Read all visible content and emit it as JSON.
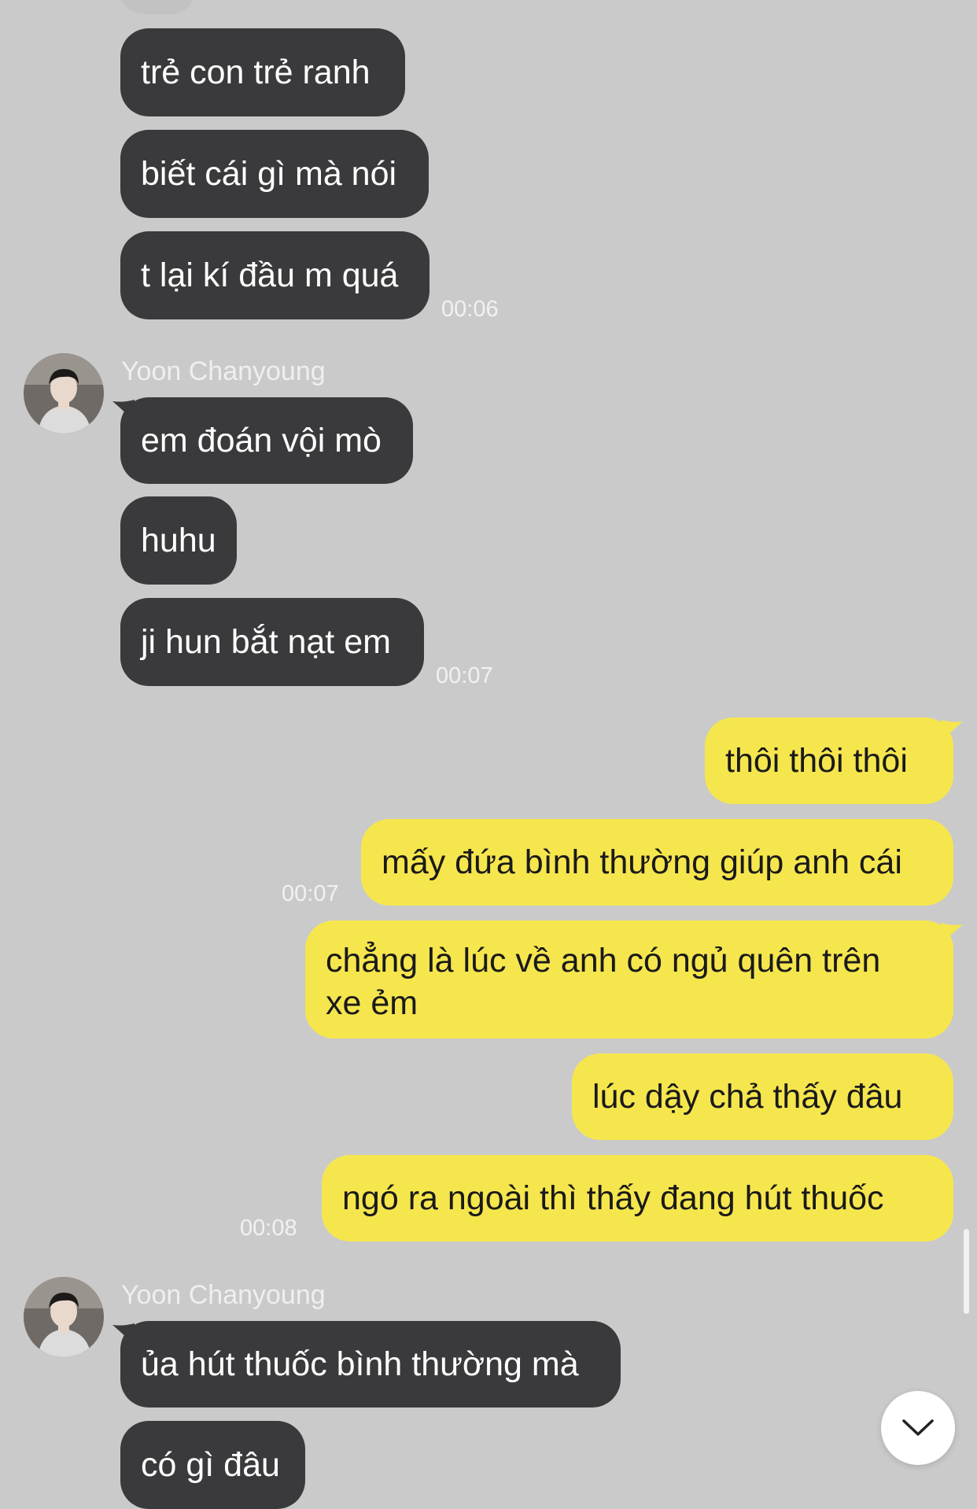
{
  "contact": {
    "name": "Yoon Chanyoung"
  },
  "colors": {
    "background": "#cacaca",
    "incoming": "#3a3a3c",
    "outgoing": "#f6e64e"
  },
  "groups": [
    {
      "messages": [
        "trẻ con trẻ ranh",
        "biết cái gì mà nói",
        "t lại kí đầu m quá"
      ],
      "time": "00:06"
    },
    {
      "messages": [
        "em đoán vội mò",
        "huhu",
        "ji hun bắt nạt em"
      ],
      "time": "00:07"
    },
    {
      "messages": [
        "thôi thôi thôi",
        "mấy đứa bình thường giúp anh cái"
      ],
      "time": "00:07"
    },
    {
      "messages": [
        "chẳng là lúc về anh có ngủ quên trên xe ẻm",
        "lúc dậy chả thấy đâu",
        "ngó ra ngoài thì thấy đang hút thuốc"
      ],
      "time": "00:08"
    },
    {
      "messages": [
        "ủa hút thuốc bình thường mà",
        "có gì đâu"
      ]
    }
  ],
  "icons": {
    "scroll_down": "chevron-down-icon",
    "avatar": "avatar"
  }
}
